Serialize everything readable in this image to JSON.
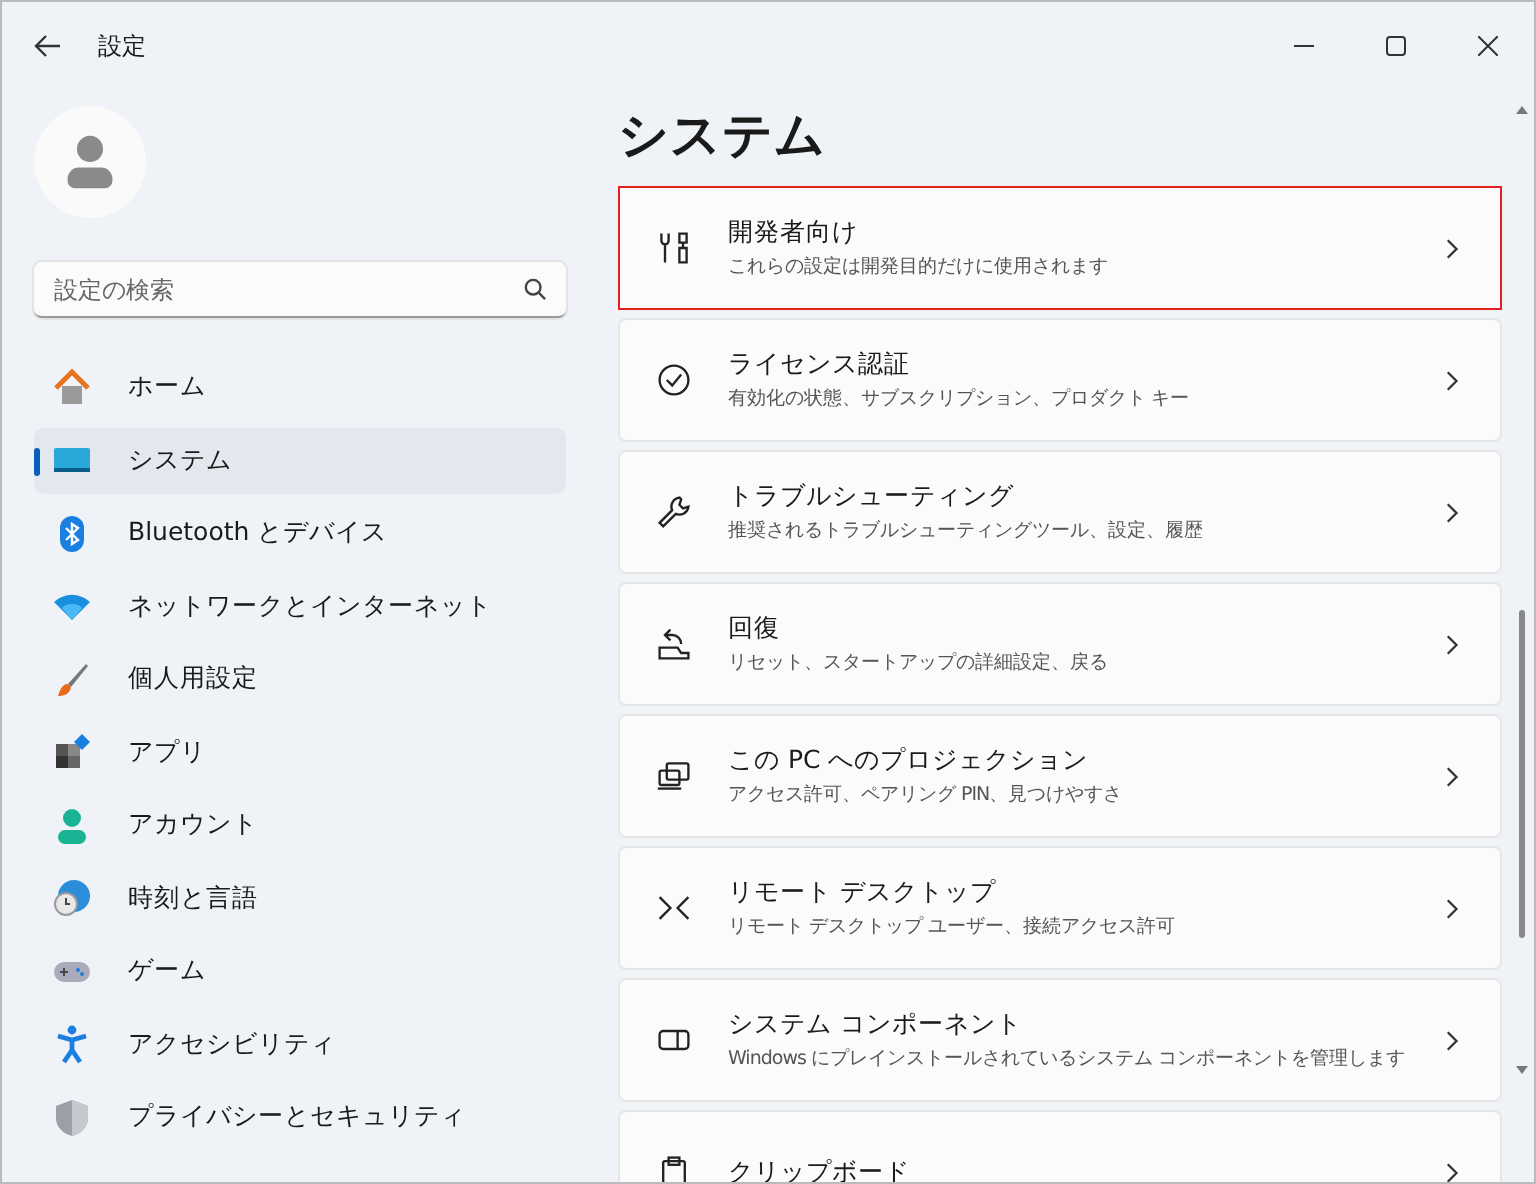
{
  "window": {
    "title": "設定"
  },
  "search": {
    "placeholder": "設定の検索"
  },
  "sidebar": {
    "items": [
      {
        "label": "ホーム",
        "selected": false
      },
      {
        "label": "システム",
        "selected": true
      },
      {
        "label": "Bluetooth とデバイス",
        "selected": false
      },
      {
        "label": "ネットワークとインターネット",
        "selected": false
      },
      {
        "label": "個人用設定",
        "selected": false
      },
      {
        "label": "アプリ",
        "selected": false
      },
      {
        "label": "アカウント",
        "selected": false
      },
      {
        "label": "時刻と言語",
        "selected": false
      },
      {
        "label": "ゲーム",
        "selected": false
      },
      {
        "label": "アクセシビリティ",
        "selected": false
      },
      {
        "label": "プライバシーとセキュリティ",
        "selected": false
      }
    ]
  },
  "page": {
    "title": "システム",
    "cards": [
      {
        "title": "開発者向け",
        "subtitle": "これらの設定は開発目的だけに使用されます",
        "highlighted": true
      },
      {
        "title": "ライセンス認証",
        "subtitle": "有効化の状態、サブスクリプション、プロダクト キー",
        "highlighted": false
      },
      {
        "title": "トラブルシューティング",
        "subtitle": "推奨されるトラブルシューティングツール、設定、履歴",
        "highlighted": false
      },
      {
        "title": "回復",
        "subtitle": "リセット、スタートアップの詳細設定、戻る",
        "highlighted": false
      },
      {
        "title": "この PC へのプロジェクション",
        "subtitle": "アクセス許可、ペアリング PIN、見つけやすさ",
        "highlighted": false
      },
      {
        "title": "リモート デスクトップ",
        "subtitle": "リモート デスクトップ ユーザー、接続アクセス許可",
        "highlighted": false
      },
      {
        "title": "システム コンポーネント",
        "subtitle": "Windows にプレインストールされているシステム コンポーネントを管理します",
        "highlighted": false
      },
      {
        "title": "クリップボード",
        "highlighted": false
      }
    ]
  }
}
